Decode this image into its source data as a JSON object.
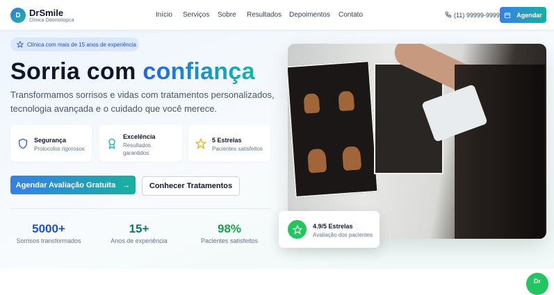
{
  "header": {
    "logo_letter": "D",
    "brand": "DrSmile",
    "brand_sub": "Clínica Odontológica",
    "nav": [
      "Início",
      "Serviços",
      "Sobre",
      "Resultados",
      "Depoimentos",
      "Contato"
    ],
    "phone": "(11) 99999-9999",
    "cta": "Agendar"
  },
  "hero": {
    "badge": "Clínica com mais de 15 anos de experiência",
    "title_main": "Sorria com ",
    "title_accent": "confiança",
    "subtitle": "Transformamos sorrisos e vidas com tratamentos personalizados, tecnologia avançada e o cuidado que você merece.",
    "features": [
      {
        "title": "Segurança",
        "desc": "Protocolos rigorosos",
        "icon": "shield-icon"
      },
      {
        "title": "Excelência",
        "desc": "Resultados garantidos",
        "icon": "award-icon"
      },
      {
        "title": "5 Estrelas",
        "desc": "Pacientes satisfeitos",
        "icon": "star-icon"
      }
    ],
    "primary_button": "Agendar Avaliação Gratuita",
    "primary_arrow": "→",
    "secondary_button": "Conhecer Tratamentos",
    "stats": [
      {
        "value": "5000+",
        "label": "Sorrisos transformados",
        "color": "#1d4ed8"
      },
      {
        "value": "15+",
        "label": "Anos de experiência",
        "color": "#0f766e"
      },
      {
        "value": "98%",
        "label": "Pacientes satisfeitos",
        "color": "#16a34a"
      }
    ],
    "rating": {
      "title": "4.9/5 Estrelas",
      "subtitle": "Avaliação dos pacientes"
    }
  },
  "fab": {
    "label": "Dr"
  },
  "colors": {
    "primary": "#3580e8",
    "teal": "#18b0a0",
    "green": "#22c55e"
  }
}
